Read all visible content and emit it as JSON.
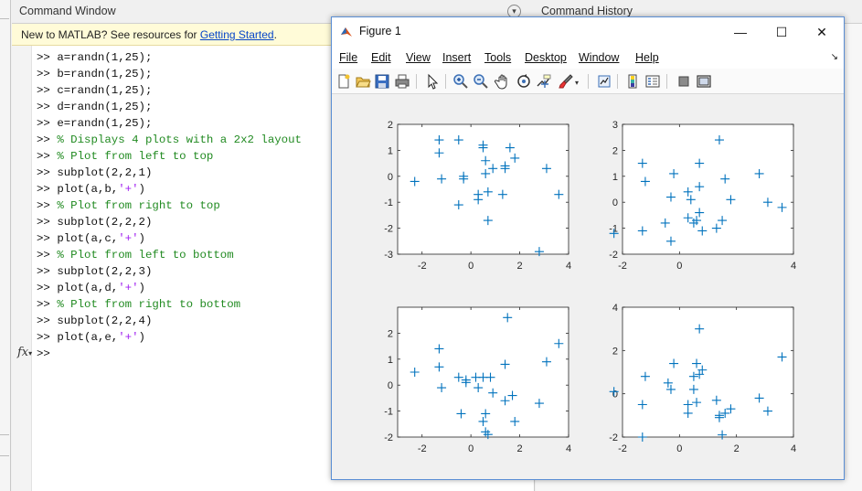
{
  "command_window": {
    "title": "Command Window",
    "banner_text": "New to MATLAB? See resources for ",
    "banner_link": "Getting Started",
    "banner_tail": ".",
    "prompt": ">>",
    "lines": [
      {
        "text": "a=randn(1,25);",
        "type": "code"
      },
      {
        "text": "b=randn(1,25);",
        "type": "code"
      },
      {
        "text": "c=randn(1,25);",
        "type": "code"
      },
      {
        "text": "d=randn(1,25);",
        "type": "code"
      },
      {
        "text": "e=randn(1,25);",
        "type": "code"
      },
      {
        "text": "% Displays 4 plots with a 2x2 layout",
        "type": "comment"
      },
      {
        "text": "% Plot from left to top",
        "type": "comment"
      },
      {
        "text": "subplot(2,2,1)",
        "type": "code"
      },
      {
        "text": "plot(a,b,'+')",
        "type": "code"
      },
      {
        "text": "% Plot from right to top",
        "type": "comment"
      },
      {
        "text": "subplot(2,2,2)",
        "type": "code"
      },
      {
        "text": "plot(a,c,'+')",
        "type": "code"
      },
      {
        "text": "% Plot from left to bottom",
        "type": "comment"
      },
      {
        "text": "subplot(2,2,3)",
        "type": "code"
      },
      {
        "text": "plot(a,d,'+')",
        "type": "code"
      },
      {
        "text": "% Plot from right to bottom",
        "type": "comment"
      },
      {
        "text": "subplot(2,2,4)",
        "type": "code"
      },
      {
        "text": "plot(a,e,'+')",
        "type": "code"
      }
    ],
    "fx_label": "fx"
  },
  "command_history": {
    "title": "Command History"
  },
  "figure": {
    "title": "Figure 1",
    "buttons": {
      "minimize": "—",
      "maximize": "☐",
      "close": "✕"
    },
    "menu": [
      "File",
      "Edit",
      "View",
      "Insert",
      "Tools",
      "Desktop",
      "Window",
      "Help"
    ],
    "toolbar": [
      "new-figure-icon",
      "open-icon",
      "save-icon",
      "print-icon",
      "pointer-icon",
      "zoom-in-icon",
      "zoom-out-icon",
      "pan-icon",
      "rotate-icon",
      "data-cursor-icon",
      "brush-icon",
      "link-icon",
      "colorbar-icon",
      "legend-icon",
      "hide-tools-icon",
      "dock-icon"
    ]
  },
  "colors": {
    "marker": "#0072bd",
    "comment": "#228b22",
    "string": "#a020f0",
    "link": "#0645c8",
    "banner": "#fffbd8"
  },
  "chart_data": [
    {
      "type": "scatter",
      "marker": "+",
      "xlim": [
        -3,
        4
      ],
      "ylim": [
        -3,
        2
      ],
      "xticks": [
        -2,
        0,
        2,
        4
      ],
      "yticks": [
        -3,
        -2,
        -1,
        0,
        1,
        2
      ],
      "x": [
        -2.3,
        -1.3,
        -1.3,
        -1.2,
        -0.5,
        -0.3,
        -0.3,
        0.3,
        0.3,
        0.5,
        0.5,
        0.6,
        0.7,
        0.7,
        0.9,
        1.3,
        1.4,
        1.6,
        1.8,
        2.8,
        3.1,
        3.6,
        0.6,
        1.4,
        -0.5
      ],
      "y": [
        -0.2,
        1.4,
        0.9,
        -0.1,
        -1.1,
        0,
        -0.1,
        -0.7,
        -0.9,
        1.2,
        1.1,
        0.6,
        -0.6,
        -1.7,
        0.3,
        -0.7,
        0.4,
        1.1,
        0.7,
        -2.9,
        0.3,
        -0.7,
        0.1,
        0.3,
        1.4
      ]
    },
    {
      "type": "scatter",
      "marker": "+",
      "xlim": [
        -2,
        4
      ],
      "ylim": [
        -2,
        3
      ],
      "xticks": [
        -2,
        0,
        4
      ],
      "yticks": [
        -2,
        -1,
        0,
        1,
        2,
        3
      ],
      "x": [
        -2.3,
        -1.3,
        -1.2,
        -1.3,
        -0.5,
        -0.3,
        -0.2,
        0.3,
        0.3,
        0.4,
        0.5,
        0.6,
        0.7,
        0.7,
        0.8,
        0.7,
        1.3,
        1.4,
        1.5,
        1.6,
        1.8,
        2.8,
        3.1,
        3.6,
        -0.3
      ],
      "y": [
        -1.2,
        1.5,
        0.8,
        -1.1,
        -0.8,
        0.2,
        1.1,
        0.4,
        -0.6,
        0.1,
        -0.8,
        -0.7,
        1.5,
        0.6,
        -1.1,
        -0.4,
        -1.0,
        2.4,
        -0.7,
        0.9,
        0.1,
        1.1,
        0,
        -0.2,
        -1.5
      ]
    },
    {
      "type": "scatter",
      "marker": "+",
      "xlim": [
        -3,
        4
      ],
      "ylim": [
        -2,
        3
      ],
      "xticks": [
        -2,
        0,
        2,
        4
      ],
      "yticks": [
        -2,
        -1,
        0,
        1,
        2
      ],
      "x": [
        -2.3,
        -1.3,
        -1.3,
        -1.2,
        -0.5,
        -0.4,
        -0.2,
        0.2,
        0.3,
        0.5,
        0.6,
        0.6,
        0.7,
        0.8,
        0.9,
        1.4,
        1.5,
        1.7,
        1.8,
        2.8,
        3.1,
        3.6,
        0.5,
        1.4,
        -0.2
      ],
      "y": [
        0.5,
        1.4,
        0.7,
        -0.1,
        0.3,
        -1.1,
        0.1,
        0.3,
        -0.1,
        -1.4,
        -1.8,
        -1.1,
        -1.9,
        0.3,
        -0.3,
        -0.6,
        2.6,
        -0.4,
        -1.4,
        -0.7,
        0.9,
        1.6,
        0.3,
        0.8,
        0.2
      ]
    },
    {
      "type": "scatter",
      "marker": "+",
      "xlim": [
        -2,
        4
      ],
      "ylim": [
        -2,
        4
      ],
      "xticks": [
        -2,
        0,
        2,
        4
      ],
      "yticks": [
        -2,
        0,
        2,
        4
      ],
      "x": [
        -2.3,
        -1.3,
        -1.2,
        -1.3,
        -0.4,
        -0.3,
        -0.2,
        0.3,
        0.3,
        0.5,
        0.5,
        0.6,
        0.7,
        0.7,
        0.8,
        1.3,
        1.4,
        1.5,
        1.6,
        1.8,
        2.8,
        3.1,
        3.6,
        0.6,
        1.4
      ],
      "y": [
        0.1,
        -0.5,
        0.8,
        -2.0,
        0.5,
        0.2,
        1.4,
        -0.5,
        -0.9,
        0.8,
        0.2,
        -0.4,
        0.9,
        3.0,
        1.1,
        -0.3,
        -1.1,
        -1.9,
        -0.9,
        -0.7,
        -0.2,
        -0.8,
        1.7,
        1.4,
        -1.0
      ]
    }
  ]
}
